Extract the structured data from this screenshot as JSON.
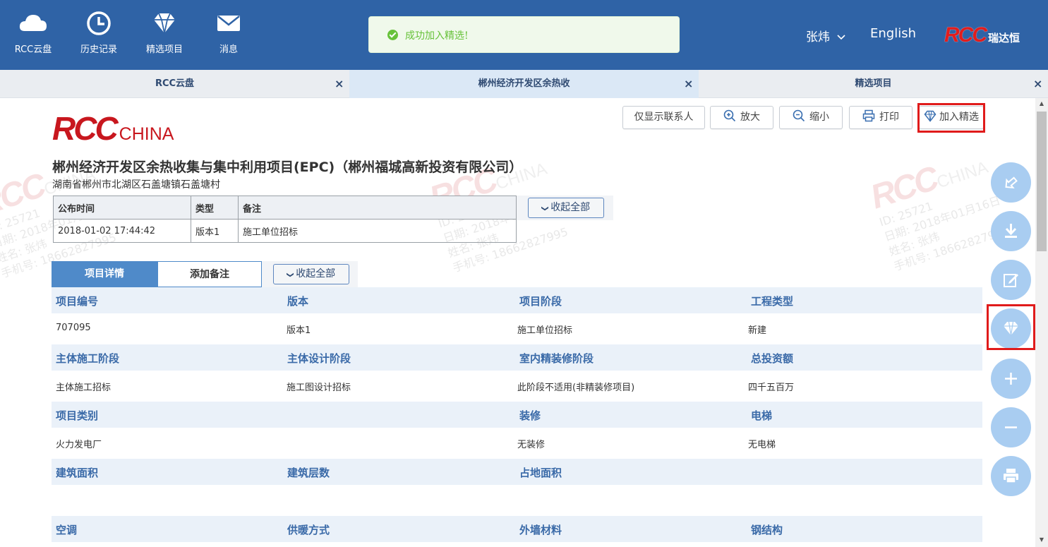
{
  "header": {
    "nav": [
      {
        "label": "RCC云盘",
        "icon": "cloud-icon"
      },
      {
        "label": "历史记录",
        "icon": "clock-icon"
      },
      {
        "label": "精选项目",
        "icon": "diamond-icon"
      },
      {
        "label": "消息",
        "icon": "mail-icon"
      }
    ],
    "toast": "成功加入精选!",
    "user": "张炜",
    "language": "English",
    "brand_logo": "RCC",
    "brand_cn": "瑞达恒"
  },
  "tabs": [
    {
      "label": "RCC云盘",
      "close": "×"
    },
    {
      "label": "郴州经济开发区余热收",
      "close": "×"
    },
    {
      "label": "精选项目",
      "close": "×"
    }
  ],
  "logo": {
    "main": "RCC",
    "sub": "CHINA"
  },
  "toolbar": {
    "contacts_only": "仅显示联系人",
    "zoom_in": "放大",
    "zoom_out": "缩小",
    "print": "打印",
    "add_featured": "加入精选"
  },
  "project": {
    "title": "郴州经济开发区余热收集与集中利用项目(EPC)（郴州福城高新投资有限公司）",
    "address": "湖南省郴州市北湖区石盖塘镇石盖塘村"
  },
  "publish_table": {
    "headers": [
      "公布时间",
      "类型",
      "备注"
    ],
    "row": [
      "2018-01-02 17:44:42",
      "版本1",
      "施工单位招标"
    ]
  },
  "collapse_all": "收起全部",
  "detail_tabs": {
    "details": "项目详情",
    "add_note": "添加备注"
  },
  "fields": [
    {
      "labels": [
        "项目编号",
        "版本",
        "项目阶段",
        "工程类型"
      ],
      "values": [
        "707095",
        "版本1",
        "施工单位招标",
        "新建"
      ]
    },
    {
      "labels": [
        "主体施工阶段",
        "主体设计阶段",
        "室内精装修阶段",
        "总投资额"
      ],
      "values": [
        "主体施工招标",
        "施工图设计招标",
        "此阶段不适用(非精装修项目)",
        "四千五百万"
      ]
    },
    {
      "labels": [
        "项目类别",
        "",
        "装修",
        "电梯"
      ],
      "values": [
        "火力发电厂",
        "",
        "无装修",
        "无电梯"
      ]
    },
    {
      "labels": [
        "建筑面积",
        "建筑层数",
        "占地面积",
        ""
      ],
      "values": [
        "",
        "",
        "",
        ""
      ]
    },
    {
      "labels": [
        "空调",
        "供暖方式",
        "外墙材料",
        "钢结构"
      ],
      "values": [
        "",
        "",
        "",
        ""
      ]
    }
  ],
  "float_tools": [
    "share-icon",
    "download-icon",
    "edit-icon",
    "diamond-icon",
    "plus-icon",
    "minus-icon",
    "print-icon"
  ],
  "watermark": {
    "logo": "RCC",
    "logo_sub": "CHINA",
    "id": "ID: 25721",
    "date": "日期: 2018年01月16日",
    "name": "姓名: 张炜",
    "phone": "手机号: 18662827995"
  }
}
